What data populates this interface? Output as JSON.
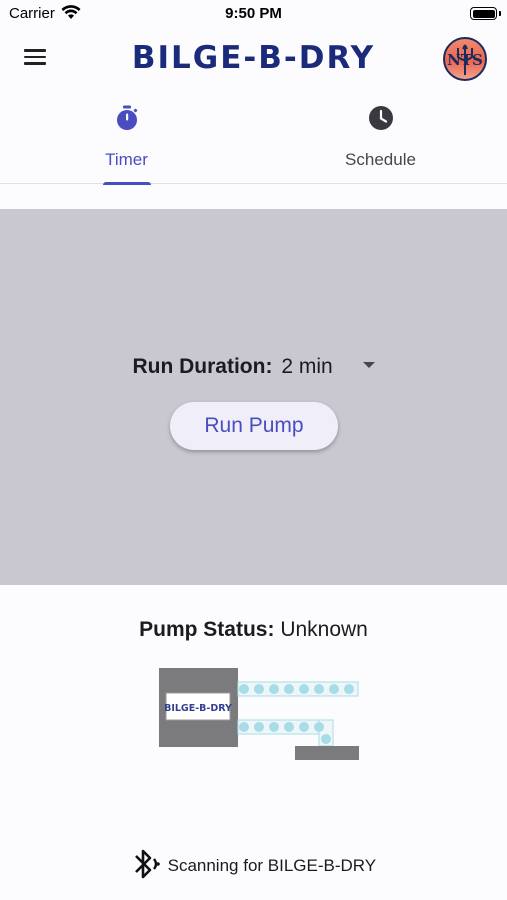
{
  "status_bar": {
    "carrier": "Carrier",
    "time": "9:50 PM"
  },
  "app_bar": {
    "title": "BILGE-B-DRY",
    "avatar_monogram": "NTS"
  },
  "tabs": [
    {
      "label": "Timer",
      "icon": "stopwatch-icon",
      "selected": true
    },
    {
      "label": "Schedule",
      "icon": "clock-icon",
      "selected": false
    }
  ],
  "timer": {
    "duration_label": "Run Duration:",
    "duration_value": "2 min",
    "run_button_label": "Run Pump"
  },
  "pump_status": {
    "label": "Pump Status:",
    "value": "Unknown"
  },
  "pump_graphic": {
    "device_label": "BILGE-B-DRY"
  },
  "bluetooth": {
    "text": "Scanning for BILGE-B-DRY"
  },
  "colors": {
    "accent": "#4a4dbf",
    "panel_bg": "#c9c8d0",
    "page_bg": "#fcfbfe",
    "water": "#a8dce6"
  }
}
